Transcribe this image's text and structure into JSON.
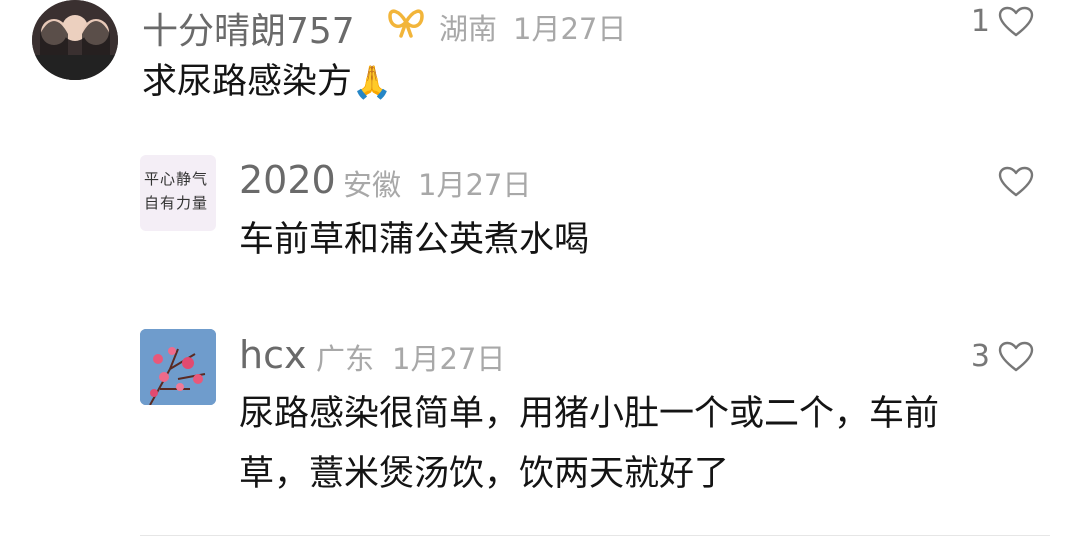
{
  "comment": {
    "username": "十分晴朗757",
    "location": "湖南",
    "date": "1月27日",
    "text": "求尿路感染方",
    "emoji": "🙏",
    "likes": "1"
  },
  "replies": [
    {
      "username": "2020",
      "location": "安徽",
      "date": "1月27日",
      "text": "车前草和蒲公英煮水喝",
      "likes": "",
      "avatar_text_line1": "平心静气",
      "avatar_text_line2": "自有力量"
    },
    {
      "username": "hcx",
      "location": "广东",
      "date": "1月27日",
      "text_line1": "尿路感染很简单，用猪小肚一个或二个，车前",
      "text_line2": "草，薏米煲汤饮，饮两天就好了",
      "likes": "3"
    }
  ],
  "colors": {
    "badge": "#f2b53a",
    "meta": "#a8a8a8",
    "name": "#6a6a6a"
  }
}
